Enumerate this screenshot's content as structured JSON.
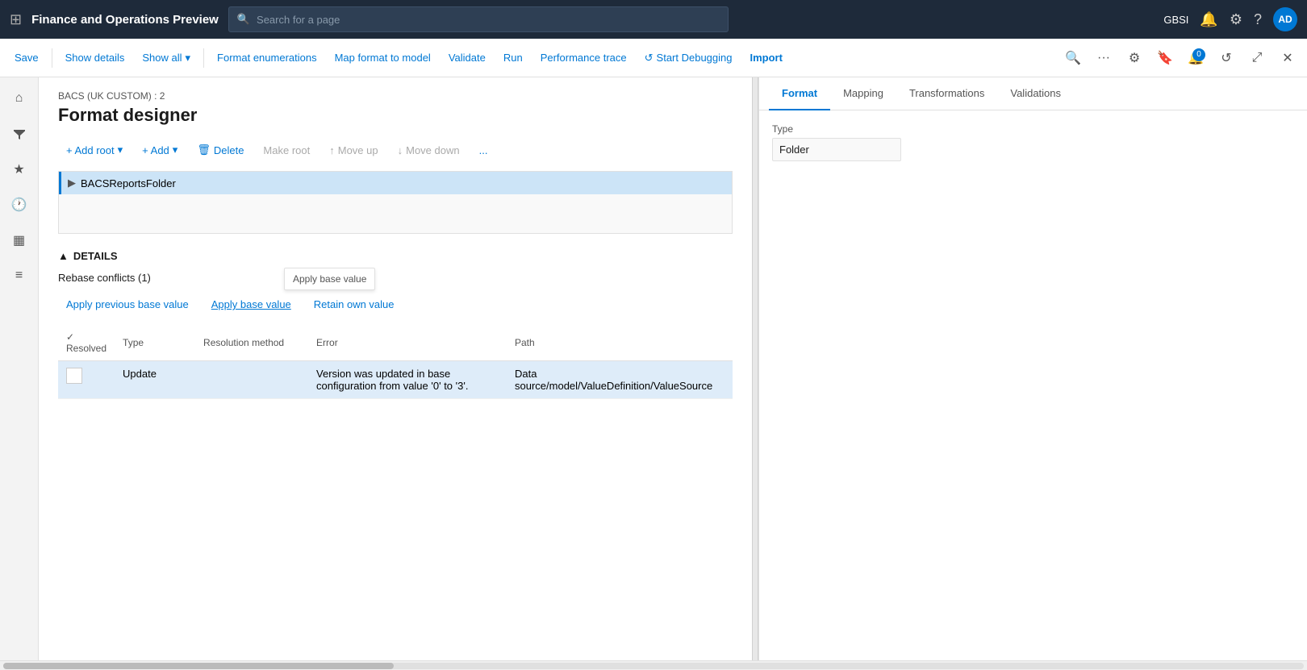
{
  "app": {
    "title": "Finance and Operations Preview",
    "search_placeholder": "Search for a page",
    "user_initials": "AD",
    "user_org": "GBSI"
  },
  "toolbar": {
    "save_label": "Save",
    "show_details_label": "Show details",
    "show_all_label": "Show all",
    "format_enumerations_label": "Format enumerations",
    "map_format_label": "Map format to model",
    "validate_label": "Validate",
    "run_label": "Run",
    "performance_trace_label": "Performance trace",
    "start_debugging_label": "Start Debugging",
    "import_label": "Import",
    "notification_count": "0"
  },
  "page": {
    "breadcrumb": "BACS (UK CUSTOM) : 2",
    "title": "Format designer"
  },
  "actions": {
    "add_root_label": "+ Add root",
    "add_label": "+ Add",
    "delete_label": "Delete",
    "make_root_label": "Make root",
    "move_up_label": "Move up",
    "move_down_label": "Move down",
    "more_label": "..."
  },
  "tabs": {
    "format_label": "Format",
    "mapping_label": "Mapping",
    "transformations_label": "Transformations",
    "validations_label": "Validations"
  },
  "tree": {
    "root_node": "BACSReportsFolder"
  },
  "right_panel": {
    "type_label": "Type",
    "type_value": "Folder"
  },
  "details": {
    "section_label": "DETAILS",
    "rebase_conflicts_label": "Rebase conflicts (1)",
    "apply_previous_label": "Apply previous base value",
    "apply_base_label": "Apply base value",
    "retain_own_label": "Retain own value",
    "tooltip_apply_base": "Apply base value"
  },
  "table": {
    "headers": [
      "Resolved",
      "Type",
      "Resolution method",
      "Error",
      "Path"
    ],
    "rows": [
      {
        "resolved": false,
        "type": "Update",
        "resolution_method": "",
        "error": "Version was updated in base configuration from value '0' to '3'.",
        "path": "Data source/model/ValueDefinition/ValueSource"
      }
    ]
  },
  "colors": {
    "accent": "#0078d4",
    "topbar_bg": "#1e2a3a",
    "selected_row": "#deecf9"
  }
}
